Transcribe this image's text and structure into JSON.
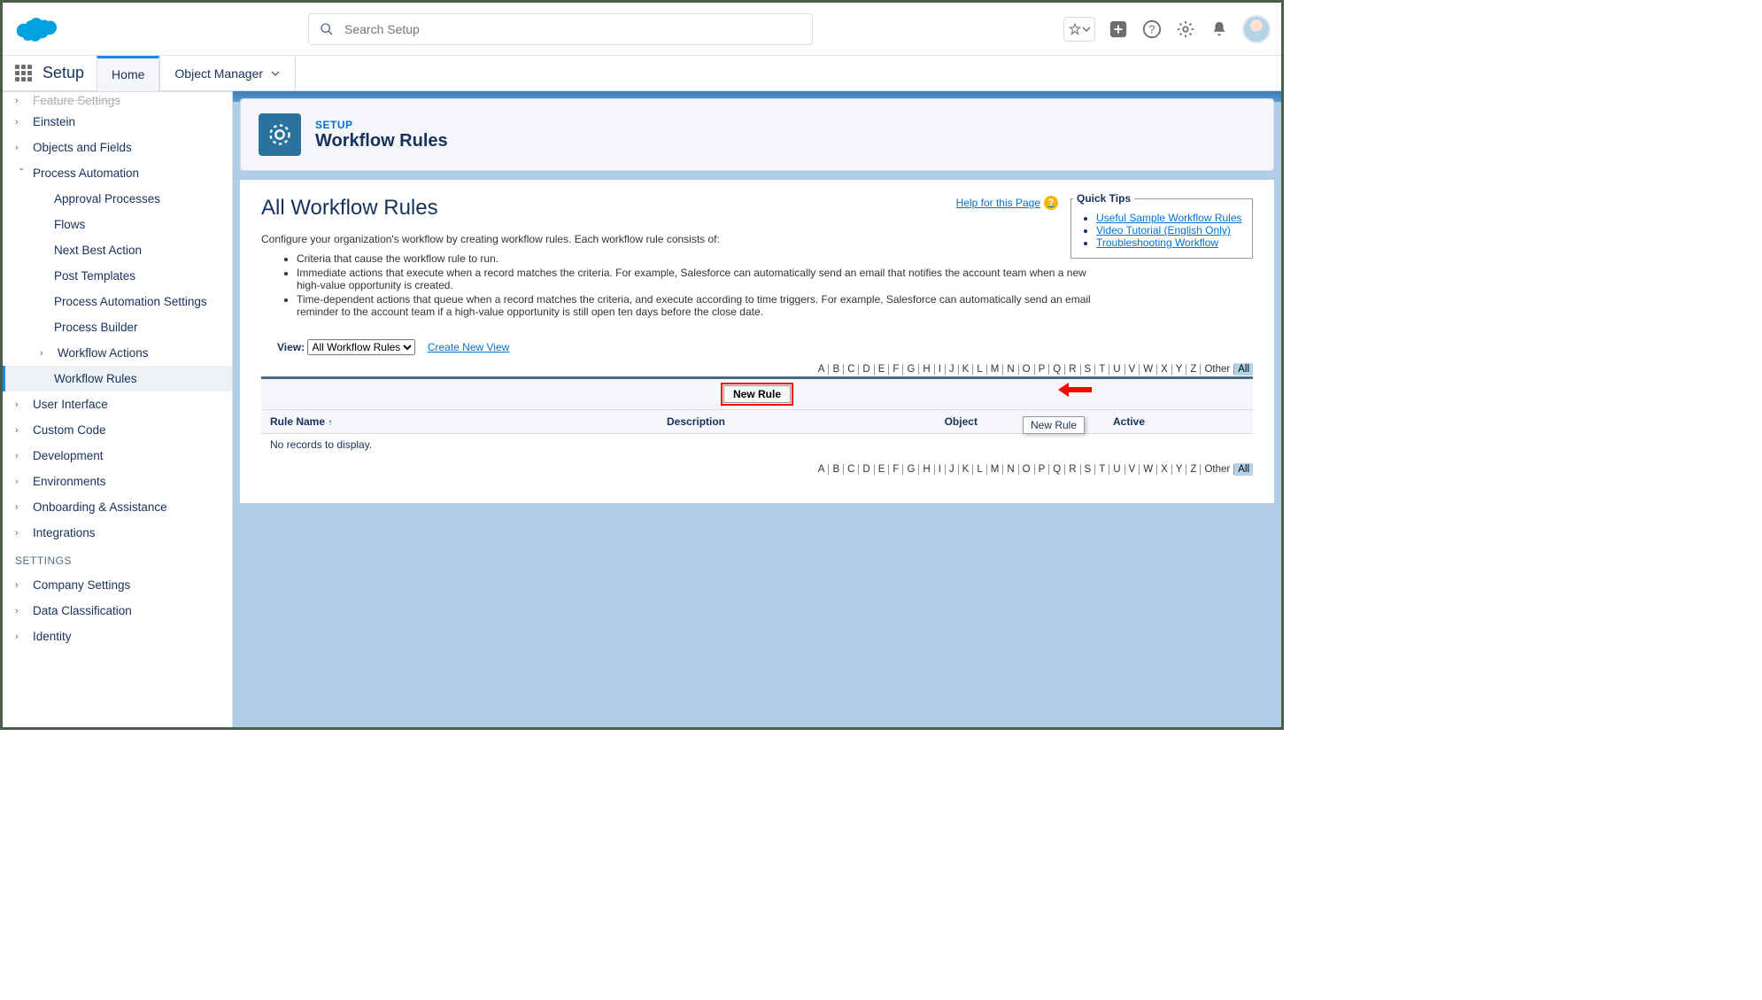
{
  "header": {
    "search_placeholder": "Search Setup"
  },
  "context": {
    "app_name": "Setup",
    "tabs": [
      {
        "label": "Home",
        "active": true
      },
      {
        "label": "Object Manager",
        "active": false
      }
    ]
  },
  "sidebar": {
    "items": [
      {
        "label": "Feature Settings",
        "collapsed": true,
        "truncated": true
      },
      {
        "label": "Einstein",
        "collapsed": true
      },
      {
        "label": "Objects and Fields",
        "collapsed": true
      },
      {
        "label": "Process Automation",
        "collapsed": false,
        "children": [
          {
            "label": "Approval Processes"
          },
          {
            "label": "Flows"
          },
          {
            "label": "Next Best Action"
          },
          {
            "label": "Post Templates"
          },
          {
            "label": "Process Automation Settings"
          },
          {
            "label": "Process Builder"
          },
          {
            "label": "Workflow Actions",
            "has_children": true
          },
          {
            "label": "Workflow Rules",
            "selected": true
          }
        ]
      },
      {
        "label": "User Interface",
        "collapsed": true
      },
      {
        "label": "Custom Code",
        "collapsed": true
      },
      {
        "label": "Development",
        "collapsed": true
      },
      {
        "label": "Environments",
        "collapsed": true
      },
      {
        "label": "Onboarding & Assistance",
        "collapsed": true
      },
      {
        "label": "Integrations",
        "collapsed": true
      }
    ],
    "section_heading": "SETTINGS",
    "settings_items": [
      {
        "label": "Company Settings",
        "collapsed": true
      },
      {
        "label": "Data Classification",
        "collapsed": true
      },
      {
        "label": "Identity",
        "collapsed": true
      }
    ]
  },
  "page_header": {
    "eyebrow": "SETUP",
    "title": "Workflow Rules"
  },
  "content": {
    "title": "All Workflow Rules",
    "help_label": "Help for this Page",
    "intro": "Configure your organization's workflow by creating workflow rules. Each workflow rule consists of:",
    "bullets": [
      "Criteria that cause the workflow rule to run.",
      "Immediate actions that execute when a record matches the criteria. For example, Salesforce can automatically send an email that notifies the account team when a new high-value opportunity is created.",
      "Time-dependent actions that queue when a record matches the criteria, and execute according to time triggers. For example, Salesforce can automatically send an email reminder to the account team if a high-value opportunity is still open ten days before the close date."
    ],
    "quick_tips": {
      "legend": "Quick Tips",
      "links": [
        "Useful Sample Workflow Rules",
        "Video Tutorial (English Only)",
        "Troubleshooting Workflow"
      ]
    },
    "view": {
      "label": "View:",
      "selected": "All Workflow Rules",
      "create_link": "Create New View"
    },
    "alpha": [
      "A",
      "B",
      "C",
      "D",
      "E",
      "F",
      "G",
      "H",
      "I",
      "J",
      "K",
      "L",
      "M",
      "N",
      "O",
      "P",
      "Q",
      "R",
      "S",
      "T",
      "U",
      "V",
      "W",
      "X",
      "Y",
      "Z",
      "Other",
      "All"
    ],
    "new_rule_button": "New Rule",
    "tooltip": "New Rule",
    "columns": [
      "Rule Name",
      "Description",
      "Object",
      "Active"
    ],
    "empty": "No records to display."
  }
}
